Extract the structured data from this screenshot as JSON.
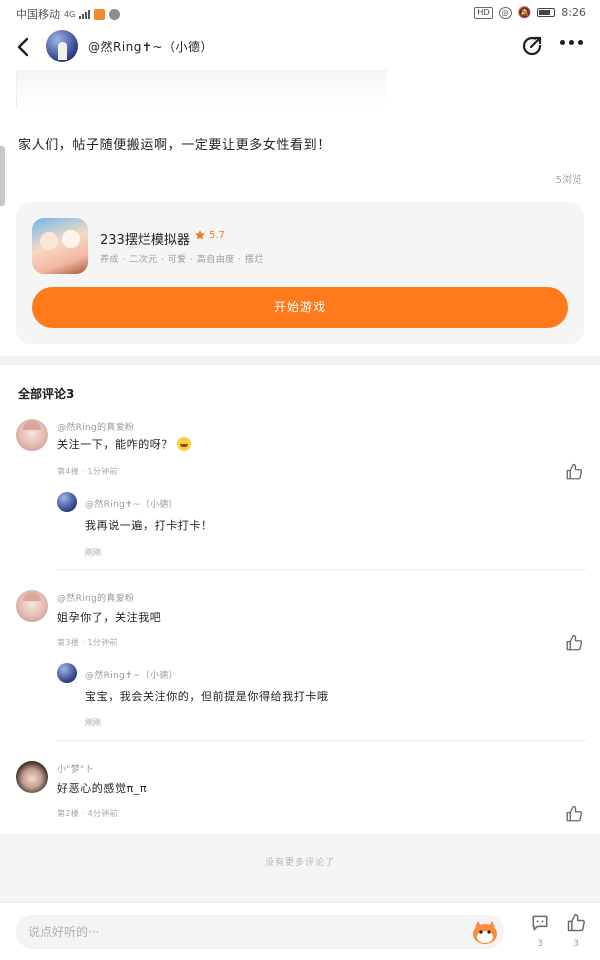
{
  "status_bar": {
    "carrier": "中国移动",
    "network": "4G",
    "hd_badge": "HD",
    "time": "8:26"
  },
  "header": {
    "author_name": "@然Ring✝~（小德）",
    "icons": [
      "back-icon",
      "share-icon",
      "more-icon"
    ]
  },
  "post": {
    "text": "家人们，帖子随便搬运啊，一定要让更多女性看到！",
    "views": "5浏览"
  },
  "game_card": {
    "name": "233摆烂模拟器",
    "rating": "5.7",
    "tags": "养成 · 二次元 · 可爱 · 高自由度 · 摆烂",
    "play_label": "开始游戏",
    "accent_color": "#ff7a1a"
  },
  "comments": {
    "title": "全部评论3",
    "items": [
      {
        "name": "@然Ring的真爱粉",
        "text": "关注一下，能咋的呀？",
        "meta": "第4楼 · 1分钟前",
        "reply": {
          "name": "@然Ring✝~（小德）",
          "text": "我再说一遍，打卡打卡！",
          "tag": "刚刚"
        }
      },
      {
        "name": "@然Ring的真爱粉",
        "text": "姐孕你了，关注我吧",
        "meta": "第3楼 · 1分钟前",
        "reply": {
          "name": "@然Ring✝~（小德）",
          "text": "宝宝，我会关注你的，但前提是你得给我打卡哦",
          "tag": "刚刚"
        }
      },
      {
        "name": "小\"梦\"卜",
        "text": "好恶心的感觉π_π",
        "meta": "第2楼 · 4分钟前"
      }
    ],
    "no_more": "没有更多评论了"
  },
  "bottom_bar": {
    "input_placeholder": "说点好听的···",
    "comment_count": "3",
    "like_count": "3"
  }
}
